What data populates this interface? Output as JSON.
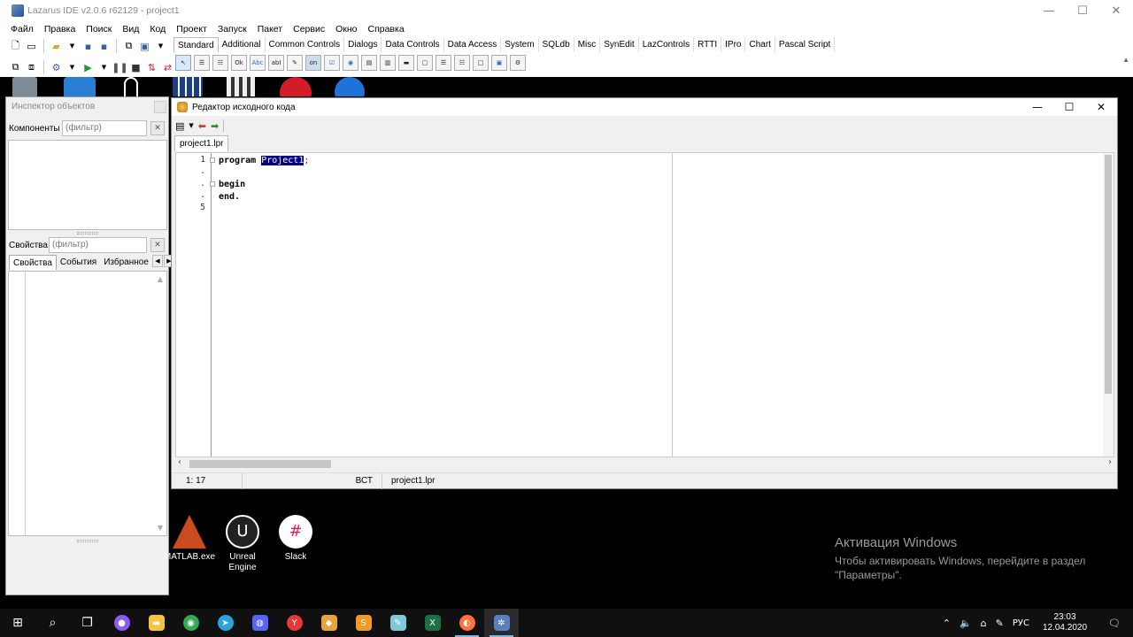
{
  "window": {
    "title": "Lazarus IDE v2.0.6 r62129 - project1",
    "minimize": "—",
    "maximize": "☐",
    "close": "✕"
  },
  "menu": [
    "Файл",
    "Правка",
    "Поиск",
    "Вид",
    "Код",
    "Проект",
    "Запуск",
    "Пакет",
    "Сервис",
    "Окно",
    "Справка"
  ],
  "palette_tabs": [
    "Standard",
    "Additional",
    "Common Controls",
    "Dialogs",
    "Data Controls",
    "Data Access",
    "System",
    "SQLdb",
    "Misc",
    "SynEdit",
    "LazControls",
    "RTTI",
    "IPro",
    "Chart",
    "Pascal Script"
  ],
  "palette_icons": [
    "pointer",
    "mainmenu",
    "popupmenu",
    "Ok",
    "Abc",
    "abl",
    "memo",
    "on",
    "check",
    "radio",
    "listbox",
    "combobox",
    "scrollbar",
    "groupbox",
    "radiogroup",
    "checkgroup",
    "panel",
    "frame",
    "actionlist"
  ],
  "palette_icon_texts": {
    "button": "Ok",
    "label": "Abc",
    "edit": "abI",
    "toggle": "on"
  },
  "inspector": {
    "title": "Инспектор объектов",
    "components_label": "Компоненты",
    "components_filter": "(фильтр)",
    "properties_label": "Свойства",
    "properties_filter": "(фильтр)",
    "tabs": [
      "Свойства",
      "События",
      "Избранное"
    ]
  },
  "editor": {
    "title": "Редактор исходного кода",
    "file_tab": "project1.lpr",
    "line_numbers": [
      "1",
      ".",
      ".",
      ".",
      "5"
    ],
    "code": {
      "line1_kw": "program",
      "line1_sel": "Project1",
      "line1_end": ";",
      "line3": "begin",
      "line4": "end."
    },
    "status": {
      "position": "1: 17",
      "mode": "ВСТ",
      "file": "project1.lpr"
    }
  },
  "desktop": {
    "shortcuts": [
      {
        "label": "MATLAB.exe",
        "color": "#c94b1f",
        "icon": "matlab-icon"
      },
      {
        "label": "Unreal Engine",
        "color": "#222222",
        "icon": "unreal-icon"
      },
      {
        "label": "Slack",
        "color": "#ffffff",
        "icon": "slack-icon"
      }
    ],
    "activation_title": "Активация Windows",
    "activation_sub": "Чтобы активировать Windows, перейдите в раздел \"Параметры\"."
  },
  "taskbar": {
    "apps": [
      {
        "name": "start",
        "glyph": "⊞",
        "color": ""
      },
      {
        "name": "search",
        "glyph": "⌕",
        "color": ""
      },
      {
        "name": "taskview",
        "glyph": "❐",
        "color": ""
      },
      {
        "name": "alice",
        "glyph": "●",
        "color": "#8a5cf6"
      },
      {
        "name": "explorer",
        "glyph": "▬",
        "color": "#f5c342"
      },
      {
        "name": "chrome",
        "glyph": "◉",
        "color": "#34a853"
      },
      {
        "name": "telegram",
        "glyph": "➤",
        "color": "#2aa3df"
      },
      {
        "name": "discord",
        "glyph": "◍",
        "color": "#5865f2"
      },
      {
        "name": "yandex",
        "glyph": "Y",
        "color": "#e53935"
      },
      {
        "name": "git",
        "glyph": "◆",
        "color": "#e8a33b"
      },
      {
        "name": "sublime",
        "glyph": "S",
        "color": "#f09a28"
      },
      {
        "name": "notepad",
        "glyph": "✎",
        "color": "#7ec8d8"
      },
      {
        "name": "excel",
        "glyph": "X",
        "color": "#1d7044"
      },
      {
        "name": "firefox",
        "glyph": "◐",
        "color": "#ff7139"
      },
      {
        "name": "lazarus",
        "glyph": "✲",
        "color": "#5b7fbf"
      }
    ],
    "tray": {
      "lang": "РУС",
      "time": "23:03",
      "date": "12.04.2020"
    }
  }
}
